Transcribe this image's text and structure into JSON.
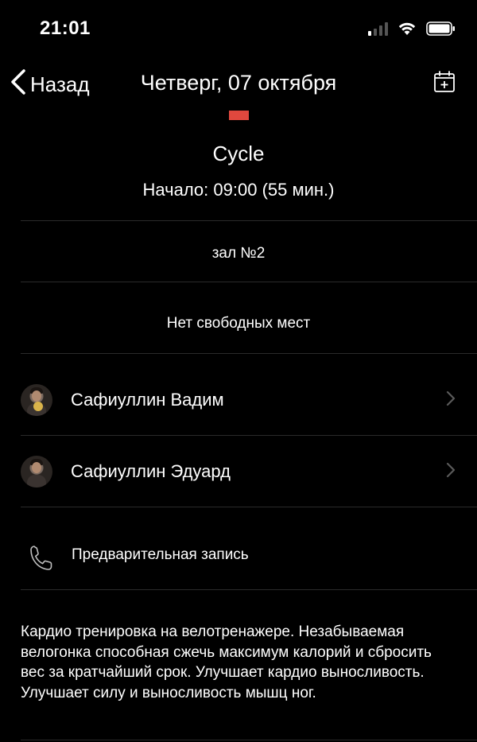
{
  "status_bar": {
    "time": "21:01"
  },
  "nav": {
    "back_label": "Назад",
    "title": "Четверг, 07 октября"
  },
  "class": {
    "color": "#e0483e",
    "name": "Cycle",
    "start": "Начало: 09:00 (55 мин.)",
    "hall": "зал №2",
    "availability": "Нет свободных мест"
  },
  "trainers": [
    {
      "name": "Сафиуллин Вадим"
    },
    {
      "name": "Сафиуллин Эдуард"
    }
  ],
  "booking": {
    "label": "Предварительная запись"
  },
  "description": "Кардио тренировка на велотренажере. Незабываемая велогонка способная сжечь максимум калорий и сбросить вес за кратчайший срок. Улучшает кардио выносливость. Улучшает силу и выносливость мышц ног."
}
